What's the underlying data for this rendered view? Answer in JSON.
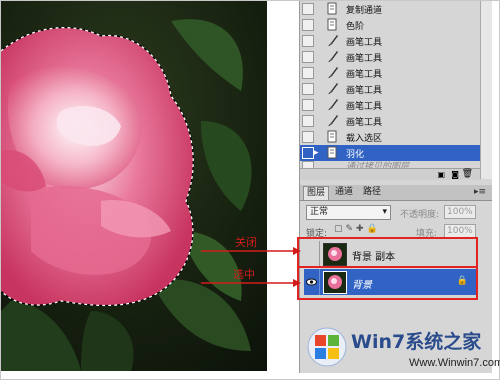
{
  "history": {
    "items": [
      {
        "label": "复制通道",
        "icon": "history-doc-icon"
      },
      {
        "label": "色阶",
        "icon": "history-doc-icon"
      },
      {
        "label": "画笔工具",
        "icon": "brush-icon"
      },
      {
        "label": "画笔工具",
        "icon": "brush-icon"
      },
      {
        "label": "画笔工具",
        "icon": "brush-icon"
      },
      {
        "label": "画笔工具",
        "icon": "brush-icon"
      },
      {
        "label": "画笔工具",
        "icon": "brush-icon"
      },
      {
        "label": "画笔工具",
        "icon": "brush-icon"
      },
      {
        "label": "载入选区",
        "icon": "history-doc-icon"
      },
      {
        "label": "羽化",
        "icon": "history-doc-icon"
      },
      {
        "label": "通过拷贝的图层",
        "icon": "history-doc-icon"
      }
    ]
  },
  "layers_panel": {
    "tabs": [
      "图层",
      "通道",
      "路径"
    ],
    "blend_mode": "正常",
    "opacity_label": "不透明度:",
    "opacity_value": "100%",
    "lock_label": "锁定:",
    "fill_label": "填充:",
    "fill_value": "100%",
    "layers": [
      {
        "name": "背景 副本"
      },
      {
        "name": "背景"
      }
    ]
  },
  "annotations": {
    "close_label": "关闭",
    "select_label": "选中",
    "accent": "#e32222"
  },
  "watermark": {
    "title": "Win7系统之家",
    "url": "Www.Winwin7.com"
  },
  "colors": {
    "selection": "#3163c5",
    "panel_bg": "#d6d6d6"
  }
}
